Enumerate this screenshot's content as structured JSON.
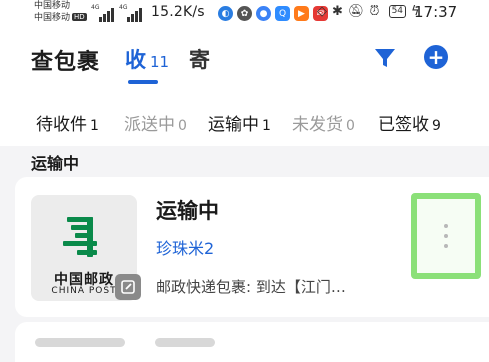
{
  "status_bar": {
    "carrier_1": "中国移动",
    "carrier_2": "中国移动",
    "hd_label": "HD",
    "network_1": "4G",
    "network_2": "4G",
    "net_speed": "15.2K/s",
    "battery": "54",
    "time": "17:37"
  },
  "header": {
    "logo": "查包裹",
    "tab_receive": "收",
    "tab_receive_count": "11",
    "tab_send": "寄"
  },
  "status_tabs": [
    {
      "label": "待收件",
      "count": "1"
    },
    {
      "label": "派送中",
      "count": "0"
    },
    {
      "label": "运输中",
      "count": "1"
    },
    {
      "label": "未发货",
      "count": "0"
    },
    {
      "label": "已签收",
      "count": "9"
    }
  ],
  "section": {
    "title": "运输中"
  },
  "parcel": {
    "carrier_logo_cn": "中国邮政",
    "carrier_logo_en": "CHINA POST",
    "status": "运输中",
    "name": "珍珠米2",
    "detail": "邮政快递包裹: 到达【江门…"
  },
  "colors": {
    "accent": "#1e63d6",
    "post_green": "#0a8a4a",
    "highlight": "#8be078"
  }
}
